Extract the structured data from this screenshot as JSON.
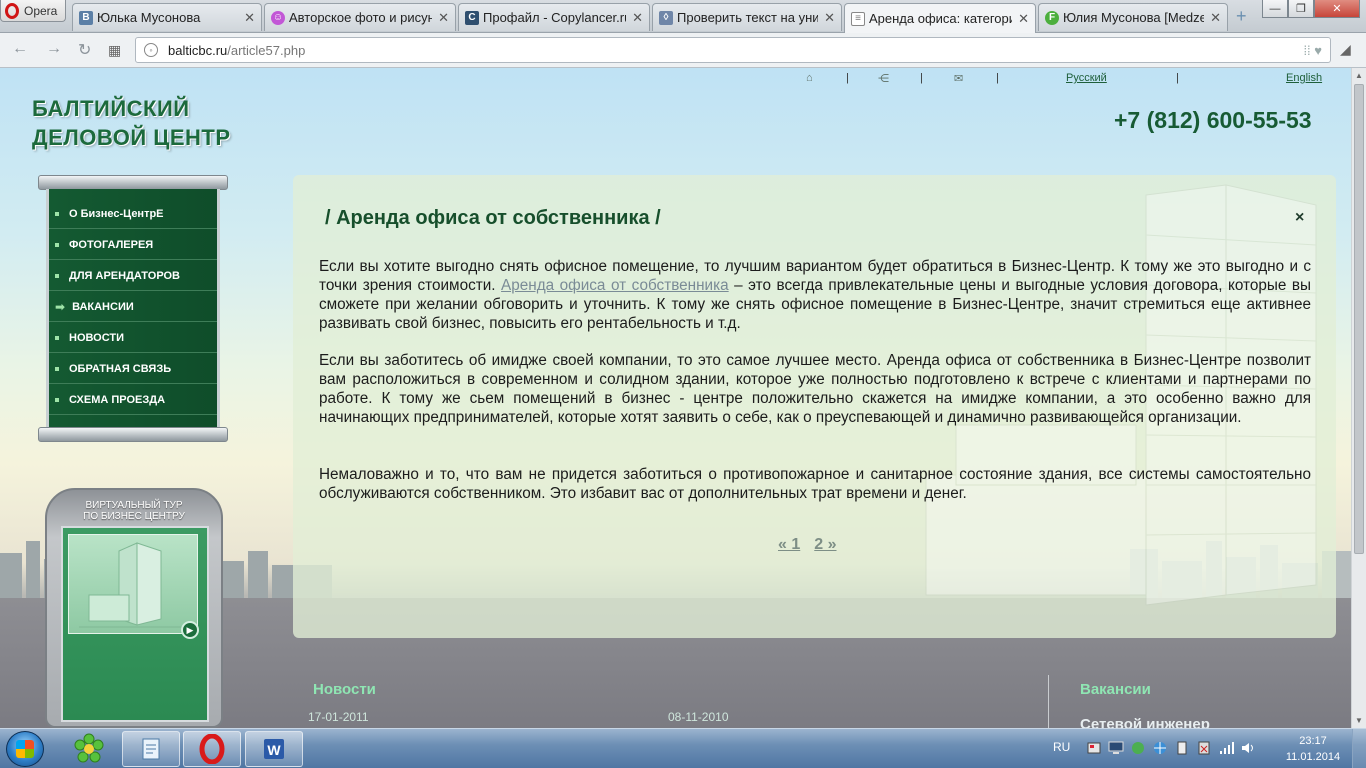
{
  "browser": {
    "menu_label": "Opera",
    "tabs": [
      {
        "title": "Юлька Мусонова",
        "favicon": "vk-icon",
        "color": "#5b7fa6",
        "letter": "B"
      },
      {
        "title": "Авторское фото и рисунк",
        "favicon": "smiley-icon",
        "color": "#c257d6",
        "letter": ""
      },
      {
        "title": "Профайл - Copylancer.ru",
        "favicon": "copylancer-icon",
        "color": "#2f4f6f",
        "letter": "C"
      },
      {
        "title": "Проверить текст на уник",
        "favicon": "shield-icon",
        "color": "#6f86a8",
        "letter": ""
      },
      {
        "title": "Аренда офиса: категори",
        "favicon": "page-icon",
        "color": "#7a7a7a",
        "letter": ""
      },
      {
        "title": "Юлия Мусонова [Medzer",
        "favicon": "medzer-icon",
        "color": "#4caf3d",
        "letter": "F"
      }
    ],
    "active_tab": 4,
    "url_host": "balticbc.ru",
    "url_path": "/article57.php"
  },
  "site": {
    "logo_line1": "БАЛТИЙСКИЙ",
    "logo_line2": "ДЕЛОВОЙ ЦЕНТР",
    "phone": "+7 (812) 600-55-53",
    "lang_ru": "Русский",
    "lang_en": "English",
    "menu": [
      {
        "label": "О Бизнес-ЦентрЕ",
        "active": false
      },
      {
        "label": "ФОТОГАЛЕРЕЯ",
        "active": false
      },
      {
        "label": "ДЛЯ АРЕНДАТОРОВ",
        "active": false
      },
      {
        "label": "ВАКАНСИИ",
        "active": true
      },
      {
        "label": "НОВОСТИ",
        "active": false
      },
      {
        "label": "ОБРАТНАЯ СВЯЗЬ",
        "active": false
      },
      {
        "label": "СХЕМА ПРОЕЗДА",
        "active": false
      }
    ],
    "tour_line1": "ВИРТУАЛЬНЫЙ ТУР",
    "tour_line2": "ПО БИЗНЕС ЦЕНТРУ"
  },
  "article": {
    "title": "/ Аренда офиса от собственника /",
    "close_glyph": "×",
    "p1_before": "Если вы хотите выгодно снять офисное помещение, то лучшим вариантом будет обратиться в Бизнес-Центр. К тому же это выгодно и с точки зрения стоимости. ",
    "p1_link": "Аренда офиса от собственника",
    "p1_after": " – это всегда привлекательные цены и выгодные условия договора, которые вы сможете при желании обговорить и уточнить. К тому же снять офисное помещение в Бизнес-Центре, значит стремиться еще активнее развивать свой бизнес, повысить его рентабельность и т.д.",
    "p2": "Если вы заботитесь об имидже своей компании, то это самое лучшее место. Аренда офиса от собственника в Бизнес-Центре позволит вам расположиться в современном и солидном здании, которое уже полностью подготовлено к встрече с клиентами и партнерами по работе. К тому же сьем помещений в бизнес - центре положительно скажется на имидже компании, а это особенно важно для начинающих предпринимателей, которые хотят заявить о себе, как о преуспевающей и динамично развивающейся организации.",
    "p3": "Немаловажно и то, что вам не придется заботиться о противопожарное и санитарное состояние здания, все системы самостоятельно обслуживаются собственником. Это избавит вас от дополнительных трат времени и денег.",
    "pager_prev": "« 1",
    "pager_next": "2 »"
  },
  "footer": {
    "news_heading": "Новости",
    "news_date_1": "17-01-2011",
    "news_date_2": "08-11-2010",
    "vacancies_heading": "Вакансии",
    "vacancy_1": "Сетевой инженер"
  },
  "taskbar": {
    "lang": "RU",
    "time": "23:17",
    "date": "11.01.2014"
  },
  "colors": {
    "brand_green": "#175b34",
    "menu_green": "#145a32",
    "accent_mint": "#8fe6b3"
  }
}
